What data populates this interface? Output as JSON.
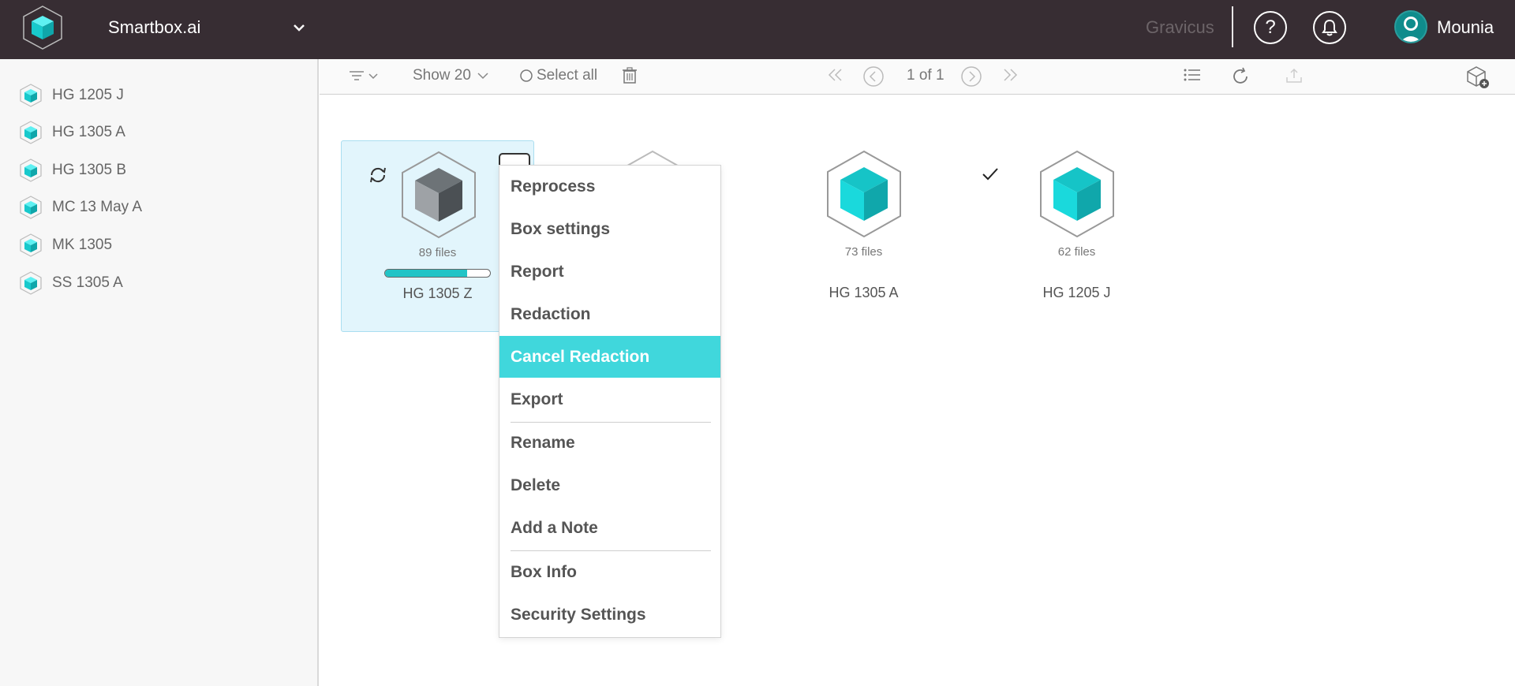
{
  "header": {
    "workspace": "Smartbox.ai",
    "organization": "Gravicus",
    "help_label": "?",
    "username": "Mounia"
  },
  "sidebar": {
    "items": [
      {
        "label": "HG 1205 J"
      },
      {
        "label": "HG 1305 A"
      },
      {
        "label": "HG 1305 B"
      },
      {
        "label": "MC 13 May A"
      },
      {
        "label": "MK 1305"
      },
      {
        "label": "SS 1305 A"
      }
    ]
  },
  "toolbar": {
    "show_label": "Show 20",
    "select_all_label": "Select all",
    "pagination": "1 of 1"
  },
  "boxes": [
    {
      "name": "HG 1305 Z",
      "files": "89 files",
      "progress": 0.78,
      "selected": true
    },
    {
      "name": "HG 1305 A",
      "files": "73 files"
    },
    {
      "name": "HG 1205 J",
      "files": "62 files",
      "checked": true
    }
  ],
  "context_menu": {
    "items": [
      "Reprocess",
      "Box settings",
      "Report",
      "Redaction",
      "Cancel Redaction",
      "Export",
      "Rename",
      "Delete",
      "Add a Note",
      "Box Info",
      "Security Settings"
    ],
    "active": "Cancel Redaction"
  },
  "colors": {
    "topbar": "#372d33",
    "accent": "#40d7dc",
    "cube_teal": "#16cccf"
  },
  "icons": [
    "logo-icon",
    "chevron-down-icon",
    "help-icon",
    "bell-icon",
    "avatar-icon",
    "box-icon",
    "filter-icon",
    "circle-icon",
    "trash-icon",
    "first-page-icon",
    "prev-page-icon",
    "next-page-icon",
    "last-page-icon",
    "list-view-icon",
    "refresh-icon",
    "upload-icon",
    "add-box-icon",
    "sync-icon",
    "check-icon",
    "more-icon"
  ]
}
